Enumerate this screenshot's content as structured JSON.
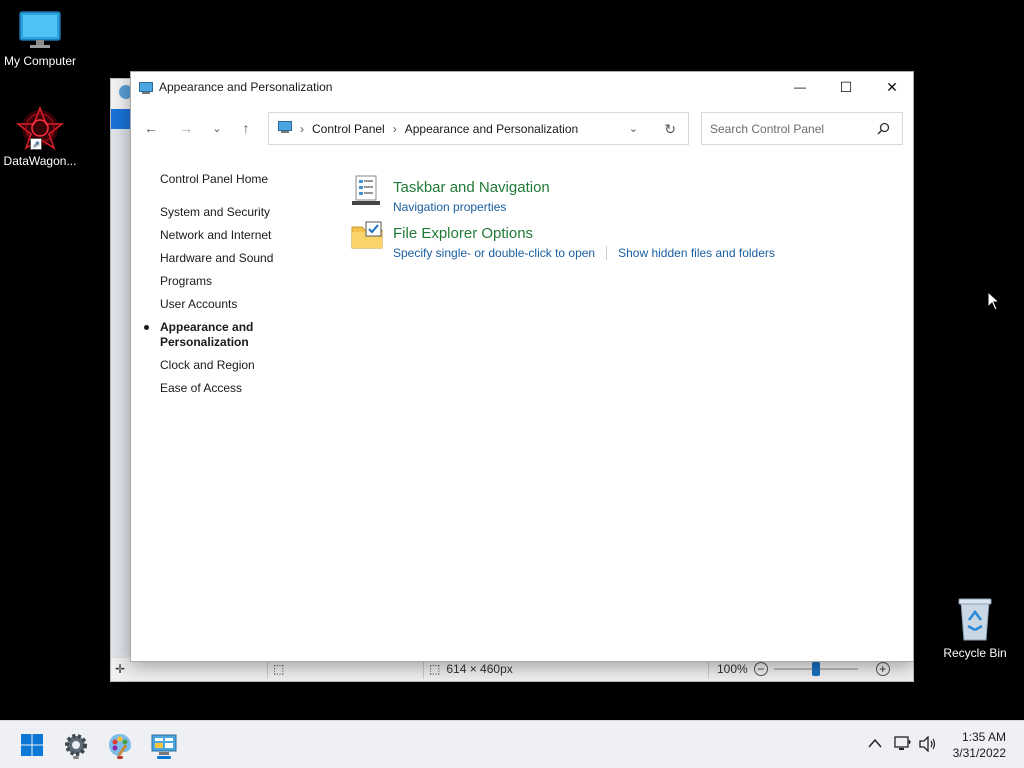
{
  "desktop": {
    "icons": [
      {
        "label": "My Computer",
        "icon": "monitor-icon"
      },
      {
        "label": "DataWagon...",
        "icon": "datawagon-icon"
      },
      {
        "label": "Recycle Bin",
        "icon": "recycle-bin-icon"
      }
    ]
  },
  "paint": {
    "status": {
      "dimensions": "614 × 460px",
      "zoom": "100%"
    }
  },
  "window": {
    "title": "Appearance and Personalization",
    "controls": {
      "minimize": "—",
      "maximize": "☐",
      "close": "✕"
    }
  },
  "nav": {
    "back": "←",
    "forward": "→",
    "recent": "⌄",
    "up": "↑"
  },
  "address": {
    "crumbs": [
      "Control Panel",
      "Appearance and Personalization"
    ],
    "separator": "›"
  },
  "search": {
    "placeholder": "Search Control Panel"
  },
  "sidebar": {
    "home": "Control Panel Home",
    "items": [
      "System and Security",
      "Network and Internet",
      "Hardware and Sound",
      "Programs",
      "User Accounts"
    ],
    "active": "Appearance and Personalization",
    "items_after": [
      "Clock and Region",
      "Ease of Access"
    ]
  },
  "categories": [
    {
      "title": "Taskbar and Navigation",
      "icon": "taskbar-icon",
      "links": [
        "Navigation properties"
      ]
    },
    {
      "title": "File Explorer Options",
      "icon": "folder-options-icon",
      "links": [
        "Specify single- or double-click to open",
        "Show hidden files and folders"
      ]
    }
  ],
  "taskbar": {
    "apps": [
      {
        "name": "start",
        "icon": "windows-start-icon"
      },
      {
        "name": "settings",
        "icon": "gear-icon"
      },
      {
        "name": "paint",
        "icon": "paint-icon"
      },
      {
        "name": "control-panel",
        "icon": "control-panel-icon"
      }
    ],
    "time": "1:35 AM",
    "date": "3/31/2022"
  }
}
